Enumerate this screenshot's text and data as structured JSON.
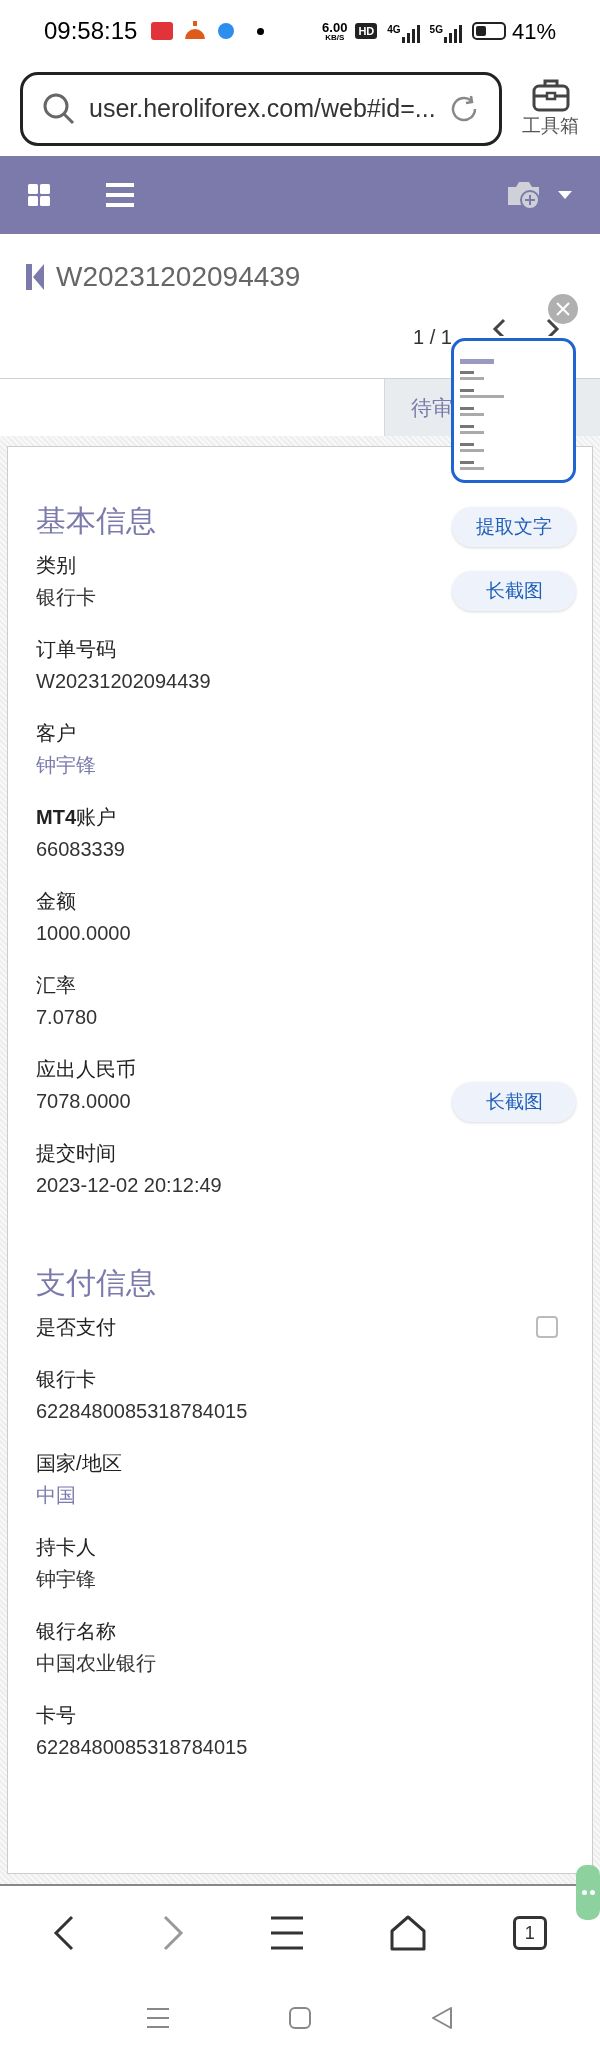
{
  "status_bar": {
    "time": "09:58:15",
    "speed_value": "6.00",
    "speed_unit": "KB/S",
    "hd": "HD",
    "networks": [
      "4G",
      "5G"
    ],
    "battery": {
      "percent": "41%"
    }
  },
  "browser": {
    "url": "user.heroliforex.com/web#id=...",
    "toolbox_label": "工具箱",
    "tab_count": "1"
  },
  "record": {
    "title": "W20231202094439",
    "pager": "1 / 1",
    "status_tab": "待审"
  },
  "tools": {
    "extract_text": "提取文字",
    "long_screenshot": "长截图",
    "long_screenshot_2": "长截图"
  },
  "sections": [
    {
      "heading": "基本信息",
      "fields": [
        {
          "kind": "text",
          "label": "类别",
          "value": "银行卡"
        },
        {
          "kind": "text",
          "label": "订单号码",
          "value": "W20231202094439"
        },
        {
          "kind": "link",
          "label": "客户",
          "value": "钟宇锋"
        },
        {
          "kind": "text",
          "label": "**MT4**账户",
          "value": "66083339"
        },
        {
          "kind": "text",
          "label": "金额",
          "value": "1000.0000"
        },
        {
          "kind": "text",
          "label": "汇率",
          "value": "7.0780"
        },
        {
          "kind": "text",
          "label": "应出人民币",
          "value": "7078.0000"
        },
        {
          "kind": "text",
          "label": "提交时间",
          "value": "2023-12-02 20:12:49"
        }
      ]
    },
    {
      "heading": "支付信息",
      "fields": [
        {
          "kind": "checkbox",
          "label": "是否支付",
          "checked": false
        },
        {
          "kind": "text",
          "label": "银行卡",
          "value": "6228480085318784015"
        },
        {
          "kind": "link",
          "label": "国家/地区",
          "value": "中国"
        },
        {
          "kind": "text",
          "label": "持卡人",
          "value": "钟宇锋"
        },
        {
          "kind": "text",
          "label": "银行名称",
          "value": "中国农业银行"
        },
        {
          "kind": "text",
          "label": "卡号",
          "value": "6228480085318784015"
        }
      ]
    }
  ]
}
